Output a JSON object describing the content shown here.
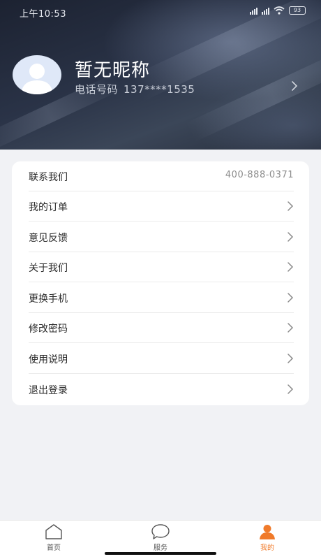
{
  "status_bar": {
    "time": "上午10:53",
    "battery": "93"
  },
  "profile": {
    "nickname": "暂无昵称",
    "phone_label": "电话号码",
    "phone_number": "137****1535"
  },
  "menu": {
    "items": [
      {
        "label": "联系我们",
        "value": "400-888-0371"
      },
      {
        "label": "我的订单"
      },
      {
        "label": "意见反馈"
      },
      {
        "label": "关于我们"
      },
      {
        "label": "更换手机"
      },
      {
        "label": "修改密码"
      },
      {
        "label": "使用说明"
      },
      {
        "label": "退出登录"
      }
    ]
  },
  "tabbar": {
    "tabs": [
      {
        "label": "首页",
        "icon": "home-icon"
      },
      {
        "label": "服务",
        "icon": "chat-bubble-icon"
      },
      {
        "label": "我的",
        "icon": "user-icon",
        "active": true
      }
    ],
    "active_color": "#f07a2a"
  },
  "colors": {
    "header_bg": "#262d3b",
    "page_bg": "#f1f2f5",
    "accent": "#f07a2a"
  }
}
